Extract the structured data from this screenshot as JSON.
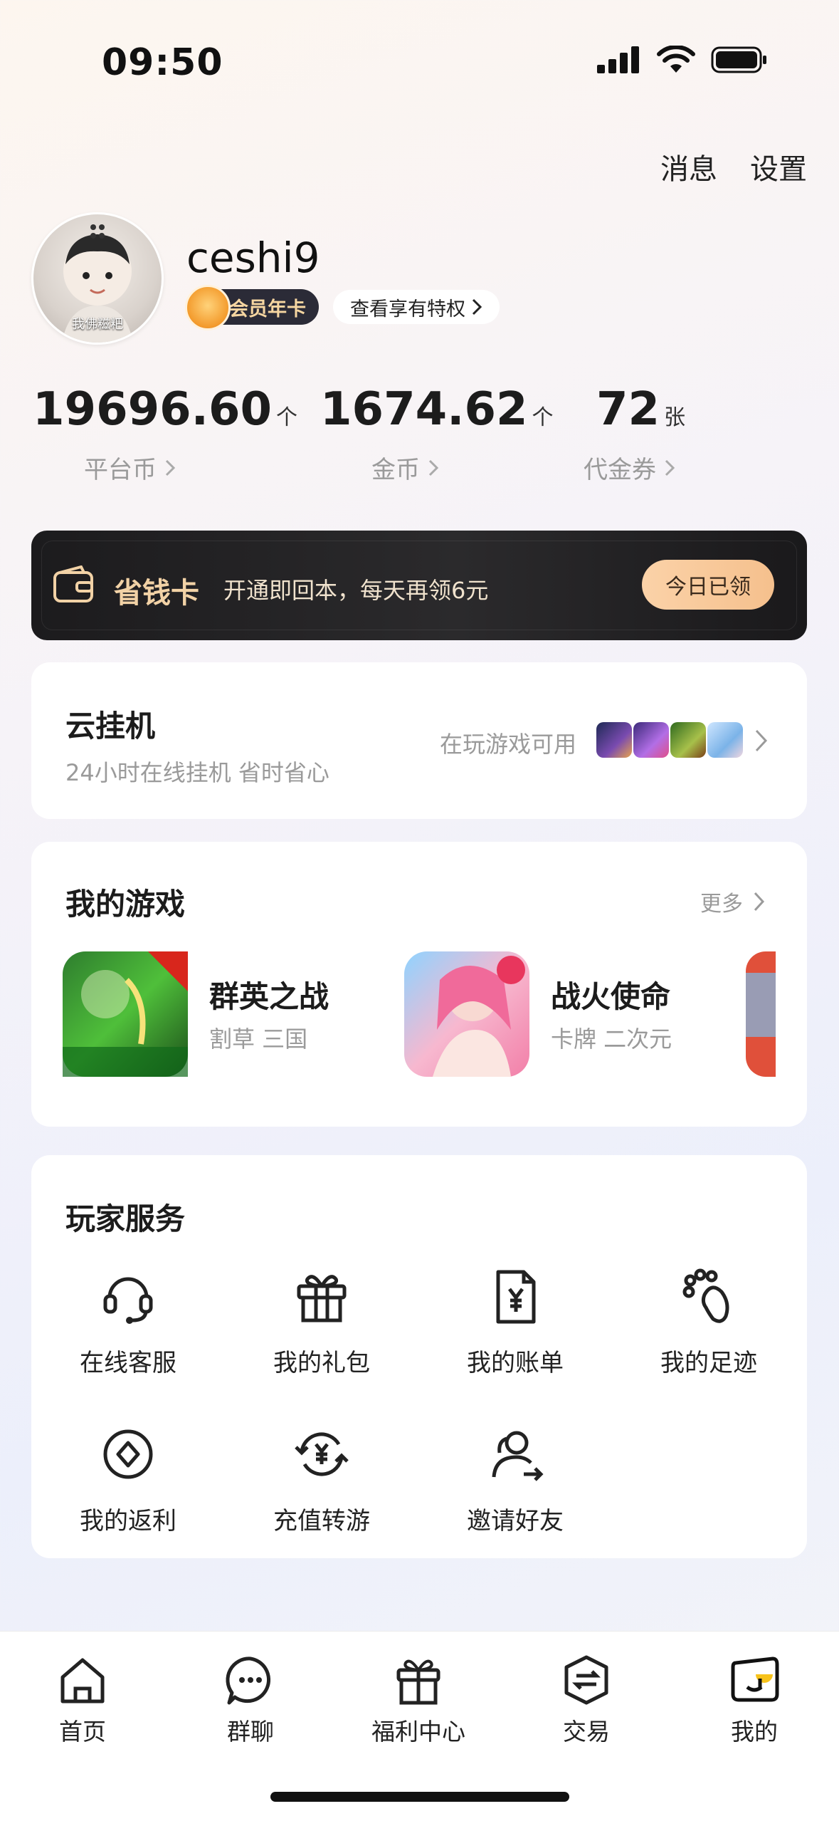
{
  "status_bar": {
    "time": "09:50"
  },
  "header": {
    "messages": "消息",
    "settings": "设置"
  },
  "profile": {
    "avatar_caption": "我佛糍粑",
    "username": "ceshi9",
    "vip_badge": "会员年卡",
    "privilege_link": "查看享有特权"
  },
  "stats": [
    {
      "value": "19696.60",
      "unit": "个",
      "label": "平台币"
    },
    {
      "value": "1674.62",
      "unit": "个",
      "label": "金币"
    },
    {
      "value": "72",
      "unit": "张",
      "label": "代金券"
    }
  ],
  "savings_card": {
    "title": "省钱卡",
    "description": "开通即回本，每天再领6元",
    "button": "今日已领"
  },
  "cloud_idle": {
    "title": "云挂机",
    "subtitle": "24小时在线挂机 省时省心",
    "available_text": "在玩游戏可用"
  },
  "my_games": {
    "title": "我的游戏",
    "more": "更多",
    "games": [
      {
        "name": "群英之战",
        "tags": "割草 三国"
      },
      {
        "name": "战火使命",
        "tags": "卡牌 二次元"
      }
    ]
  },
  "player_services": {
    "title": "玩家服务",
    "items": [
      {
        "label": "在线客服",
        "icon": "headset-icon"
      },
      {
        "label": "我的礼包",
        "icon": "gift-icon"
      },
      {
        "label": "我的账单",
        "icon": "bill-icon"
      },
      {
        "label": "我的足迹",
        "icon": "footprint-icon"
      },
      {
        "label": "我的返利",
        "icon": "rebate-icon"
      },
      {
        "label": "充值转游",
        "icon": "recharge-transfer-icon"
      },
      {
        "label": "邀请好友",
        "icon": "invite-friend-icon"
      }
    ]
  },
  "bottom_nav": [
    {
      "label": "首页",
      "icon": "home-icon"
    },
    {
      "label": "群聊",
      "icon": "chat-icon"
    },
    {
      "label": "福利中心",
      "icon": "welfare-icon"
    },
    {
      "label": "交易",
      "icon": "trade-icon"
    },
    {
      "label": "我的",
      "icon": "profile-icon"
    }
  ],
  "colors": {
    "accent_gold": "#f2d2a6",
    "save_button": "#f5c08d",
    "dark_card": "#1c1b1d"
  }
}
